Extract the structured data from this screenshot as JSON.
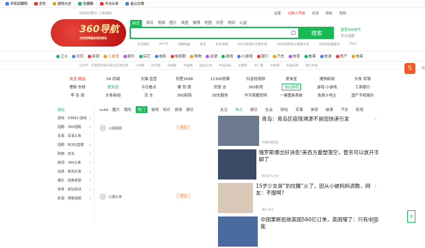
{
  "topbar": {
    "items": [
      {
        "icon": "phone-icon",
        "label": "手机收藏网",
        "color": "#3b82f6"
      },
      {
        "icon": "jd-icon",
        "label": "京东",
        "color": "#e33"
      },
      {
        "icon": "game-icon",
        "label": "游戏大全",
        "color": "#f59e0b"
      },
      {
        "icon": "taobao-icon",
        "label": "去健圈",
        "color": "#19b955"
      },
      {
        "icon": "toutiao-icon",
        "label": "今日头条",
        "color": "#e33"
      },
      {
        "icon": "gold-icon",
        "label": "金山文档",
        "color": "#3b82f6"
      }
    ]
  },
  "datebar": {
    "date": "3月6日周日",
    "lunar": "二月初四",
    "links": [
      "设置",
      "切换小号版",
      "反馈",
      "隐私",
      "帮助"
    ]
  },
  "logo": {
    "big": "360导航",
    "small": "为你找到最有用的网址"
  },
  "search": {
    "tabs": [
      "网页",
      "资讯",
      "视频",
      "图片",
      "良医",
      "微博",
      "地图",
      "问答",
      "地码",
      "公益"
    ],
    "active": 0,
    "placeholder": "",
    "button": "搜索",
    "hot": [
      "京东网页",
      "win11",
      "同期热血",
      "淘宝",
      "京东商城",
      "2022年四叶子哈尔滨",
      "1950年陈奇火箭图大阵",
      "360浏览器电子",
      "Pixiv"
    ]
  },
  "login": {
    "title": "登录360帐号",
    "subtitle": "关注话题"
  },
  "nav": {
    "items": [
      "卫士",
      "日历",
      "新闻",
      "小游戏",
      "娱乐",
      "综艺",
      "电影",
      "电视剧",
      "购物",
      "动漫",
      "游戏",
      "小游戏",
      "银行",
      "汽车",
      "体育",
      "故事",
      "旅游",
      "房产",
      "电商"
    ],
    "active": 3
  },
  "notice": {
    "items": [
      "习近平：不能把容错纠错当作避风港",
      "人民网",
      "新华网",
      "央视网",
      "中国网",
      "国际在线",
      "中国日报",
      "光明网",
      "央广网",
      "中青网",
      "中国军网",
      "网信中国"
    ]
  },
  "sites": [
    {
      "label": "淘宝·精选",
      "c": "#e33"
    },
    {
      "label": "58 同城",
      "c": ""
    },
    {
      "label": "天猫·直营",
      "c": ""
    },
    {
      "label": "同里1688",
      "c": ""
    },
    {
      "label": "12306抢票",
      "c": ""
    },
    {
      "label": "抖音短视频",
      "c": ""
    },
    {
      "label": "爱淘宝",
      "c": ""
    },
    {
      "label": "搜狗新闻",
      "c": ""
    },
    {
      "label": "头条·军情",
      "c": ""
    },
    {
      "label": "理财·东财",
      "c": ""
    },
    {
      "label": "爱淘宝",
      "c": "#19b955"
    },
    {
      "label": "今日看点",
      "c": ""
    },
    {
      "label": "聚 划 算",
      "c": ""
    },
    {
      "label": "安居 吉",
      "c": ""
    },
    {
      "label": "360影视",
      "c": ""
    },
    {
      "label": "360游戏",
      "c": "bdg"
    },
    {
      "label": "游戏·小游戏",
      "c": ""
    },
    {
      "label": "工商银行",
      "c": ""
    },
    {
      "label": "李 佳 琦",
      "c": ""
    },
    {
      "label": "头条新闻",
      "c": ""
    },
    {
      "label": "京 东",
      "c": ""
    },
    {
      "label": "360影院",
      "c": ""
    },
    {
      "label": "58车服务",
      "c": ""
    },
    {
      "label": "华为荣耀官网",
      "c": ""
    },
    {
      "label": "一键重装系统",
      "c": ""
    },
    {
      "label": "免费斗地主",
      "c": ""
    },
    {
      "label": "国产手机报价",
      "c": ""
    }
  ],
  "side": {
    "header": "顺站",
    "items": [
      "游戏 · 4399小游戏",
      "招聘 · 360招聘",
      "军事 · 军事头条",
      "招聘 · BOSS直聘",
      "购物 · 京东",
      "新闻 · 360头条",
      "动漫 · 新闻头条",
      "娱乐 · 经典老歌",
      "体育 · 体坛快讯",
      "影视 · 搜狐视频"
    ]
  },
  "mid": {
    "tabs": [
      "cube · 魔方",
      "我的",
      "热门",
      "游戏",
      "知识",
      "游戏",
      "娱乐"
    ],
    "active": 2,
    "rows": [
      {
        "name": "火爆视频",
        "follow": "关注"
      },
      {
        "name": "火爆头条",
        "follow": "关注"
      }
    ]
  },
  "news": {
    "tabs": [
      "关注",
      "热点",
      "娱乐",
      "社会",
      "财经",
      "军事",
      "体育",
      "故事",
      "汽车",
      "影视"
    ],
    "active": 1,
    "items": [
      {
        "title": "青岛：青岛区疫情溯源不是因快递引发",
        "meta": "齐鲁新闻报道",
        "c": "#6b7a8c"
      },
      {
        "title": "俄罗斯爆出好消息!美西方重塑落空，普京可以放开手脚了",
        "meta": "每日资讯·关注",
        "c": "#3b4a66"
      },
      {
        "title": "15岁少女是“豹纹腰”火了，因从小被妈妈调教，网友：不服啊？",
        "meta": "娱乐·关注",
        "c": "#d9c7b8"
      },
      {
        "title": "中国果断拒绝英国560亿订单，英国懵了：只有中国能",
        "meta": "",
        "c": "#4a6aa0"
      }
    ]
  },
  "float": {
    "label": "S",
    "tag": "中"
  },
  "totop": "顶"
}
